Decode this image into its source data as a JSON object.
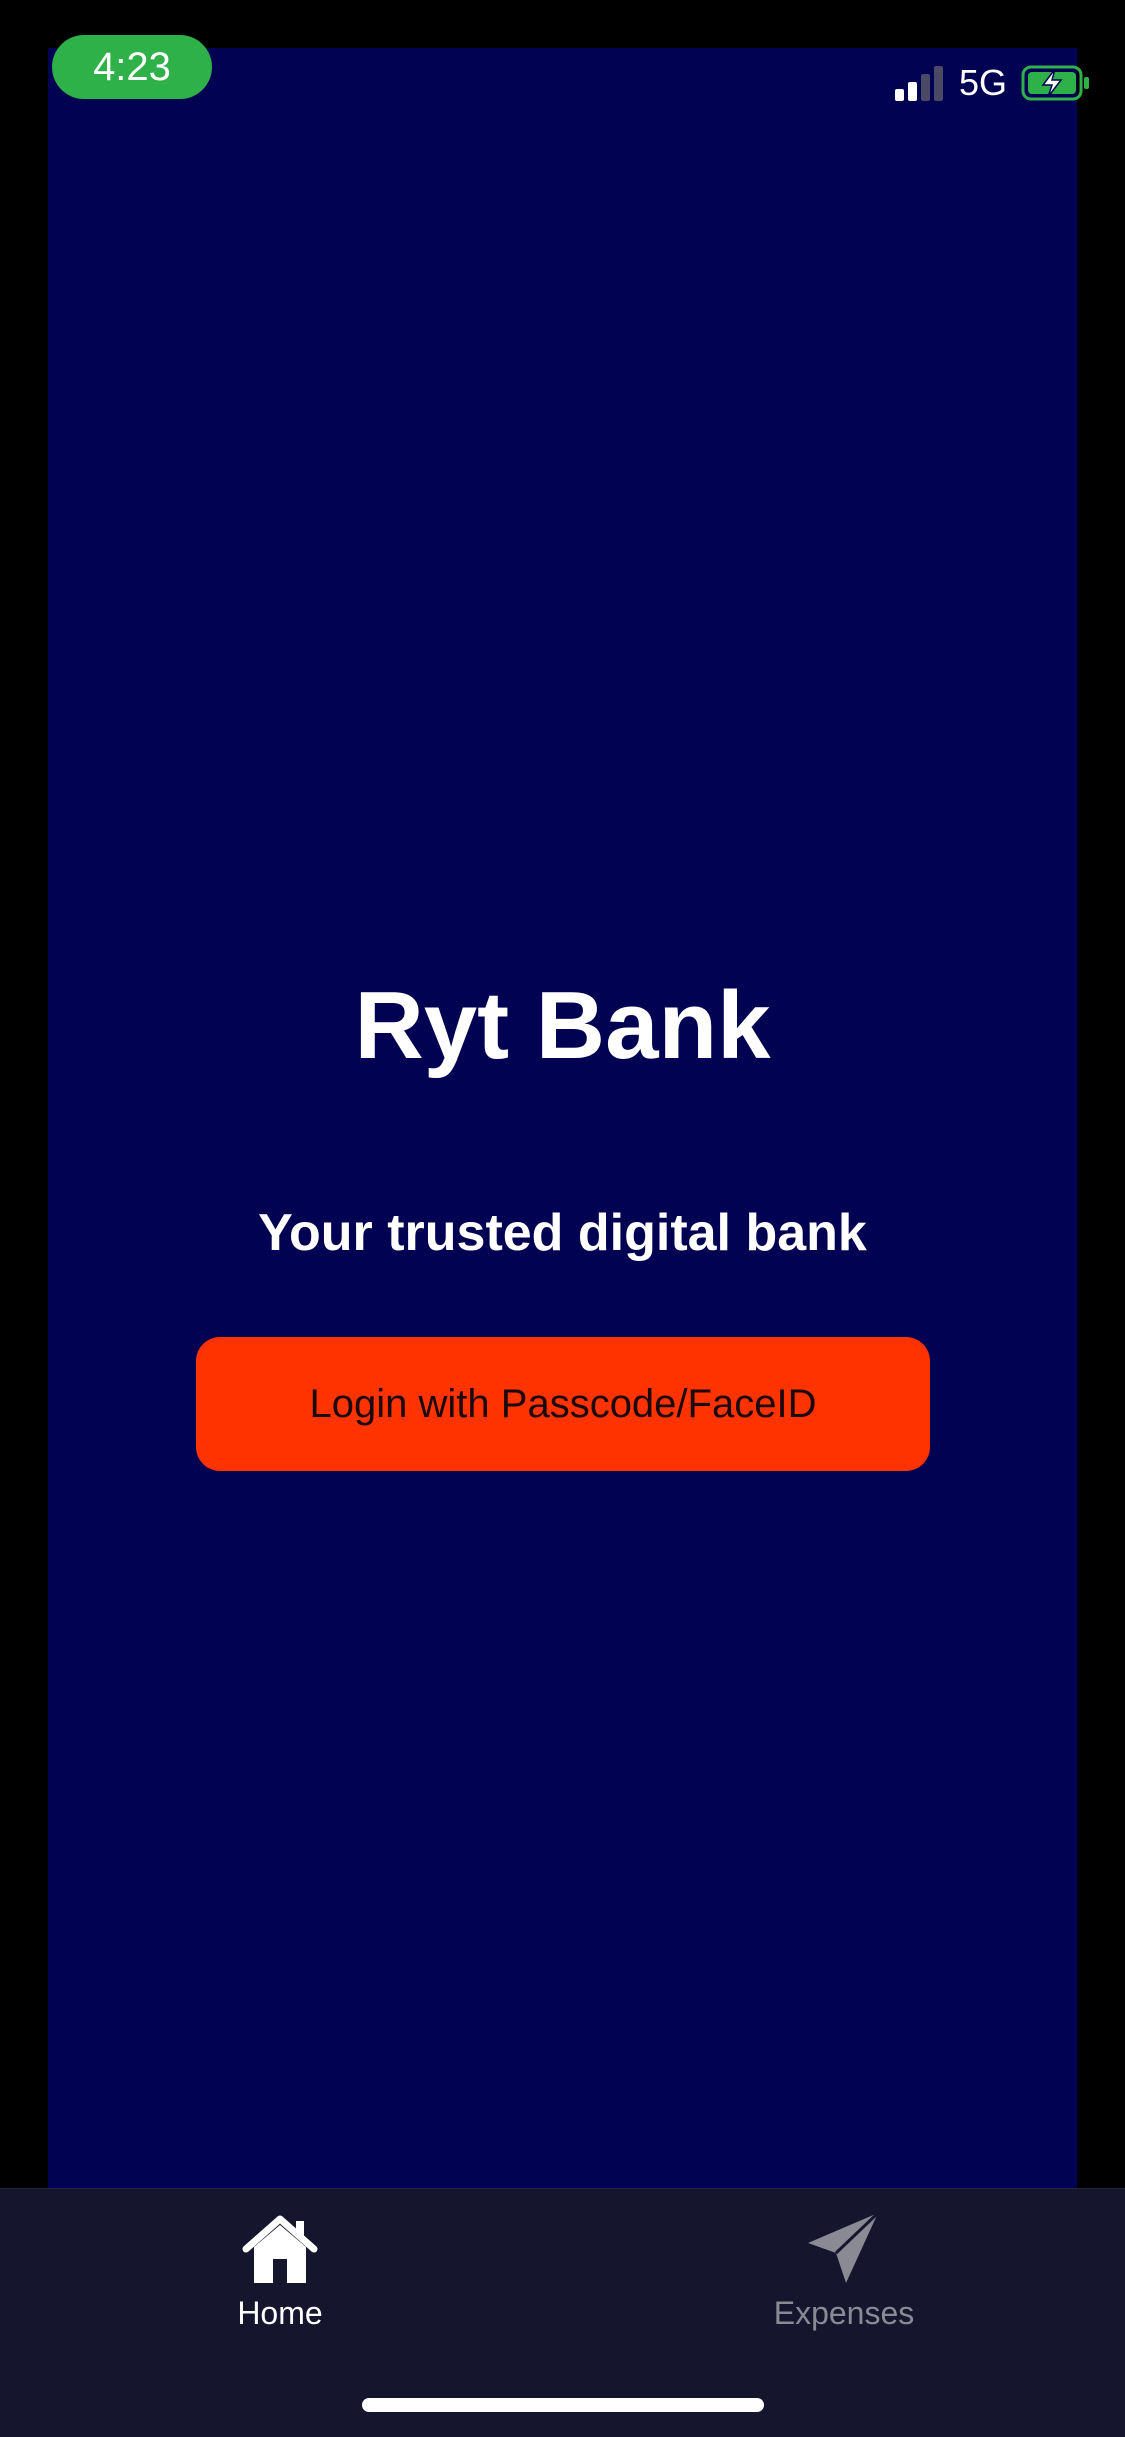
{
  "status_bar": {
    "time": "4:23",
    "network": "5G",
    "icons": [
      "signal-icon",
      "battery-charging-icon"
    ]
  },
  "main": {
    "title": "Ryt Bank",
    "tagline": "Your trusted digital bank",
    "login_button_label": "Login with Passcode/FaceID"
  },
  "tab_bar": {
    "tabs": [
      {
        "label": "Home",
        "icon": "home-icon",
        "active": true
      },
      {
        "label": "Expenses",
        "icon": "paper-plane-icon",
        "active": false
      }
    ]
  },
  "colors": {
    "background": "#020252",
    "accent": "#ff3300",
    "tab_bar": "#15152e",
    "time_pill": "#2fb14a",
    "inactive_tab": "#8a8a94"
  }
}
